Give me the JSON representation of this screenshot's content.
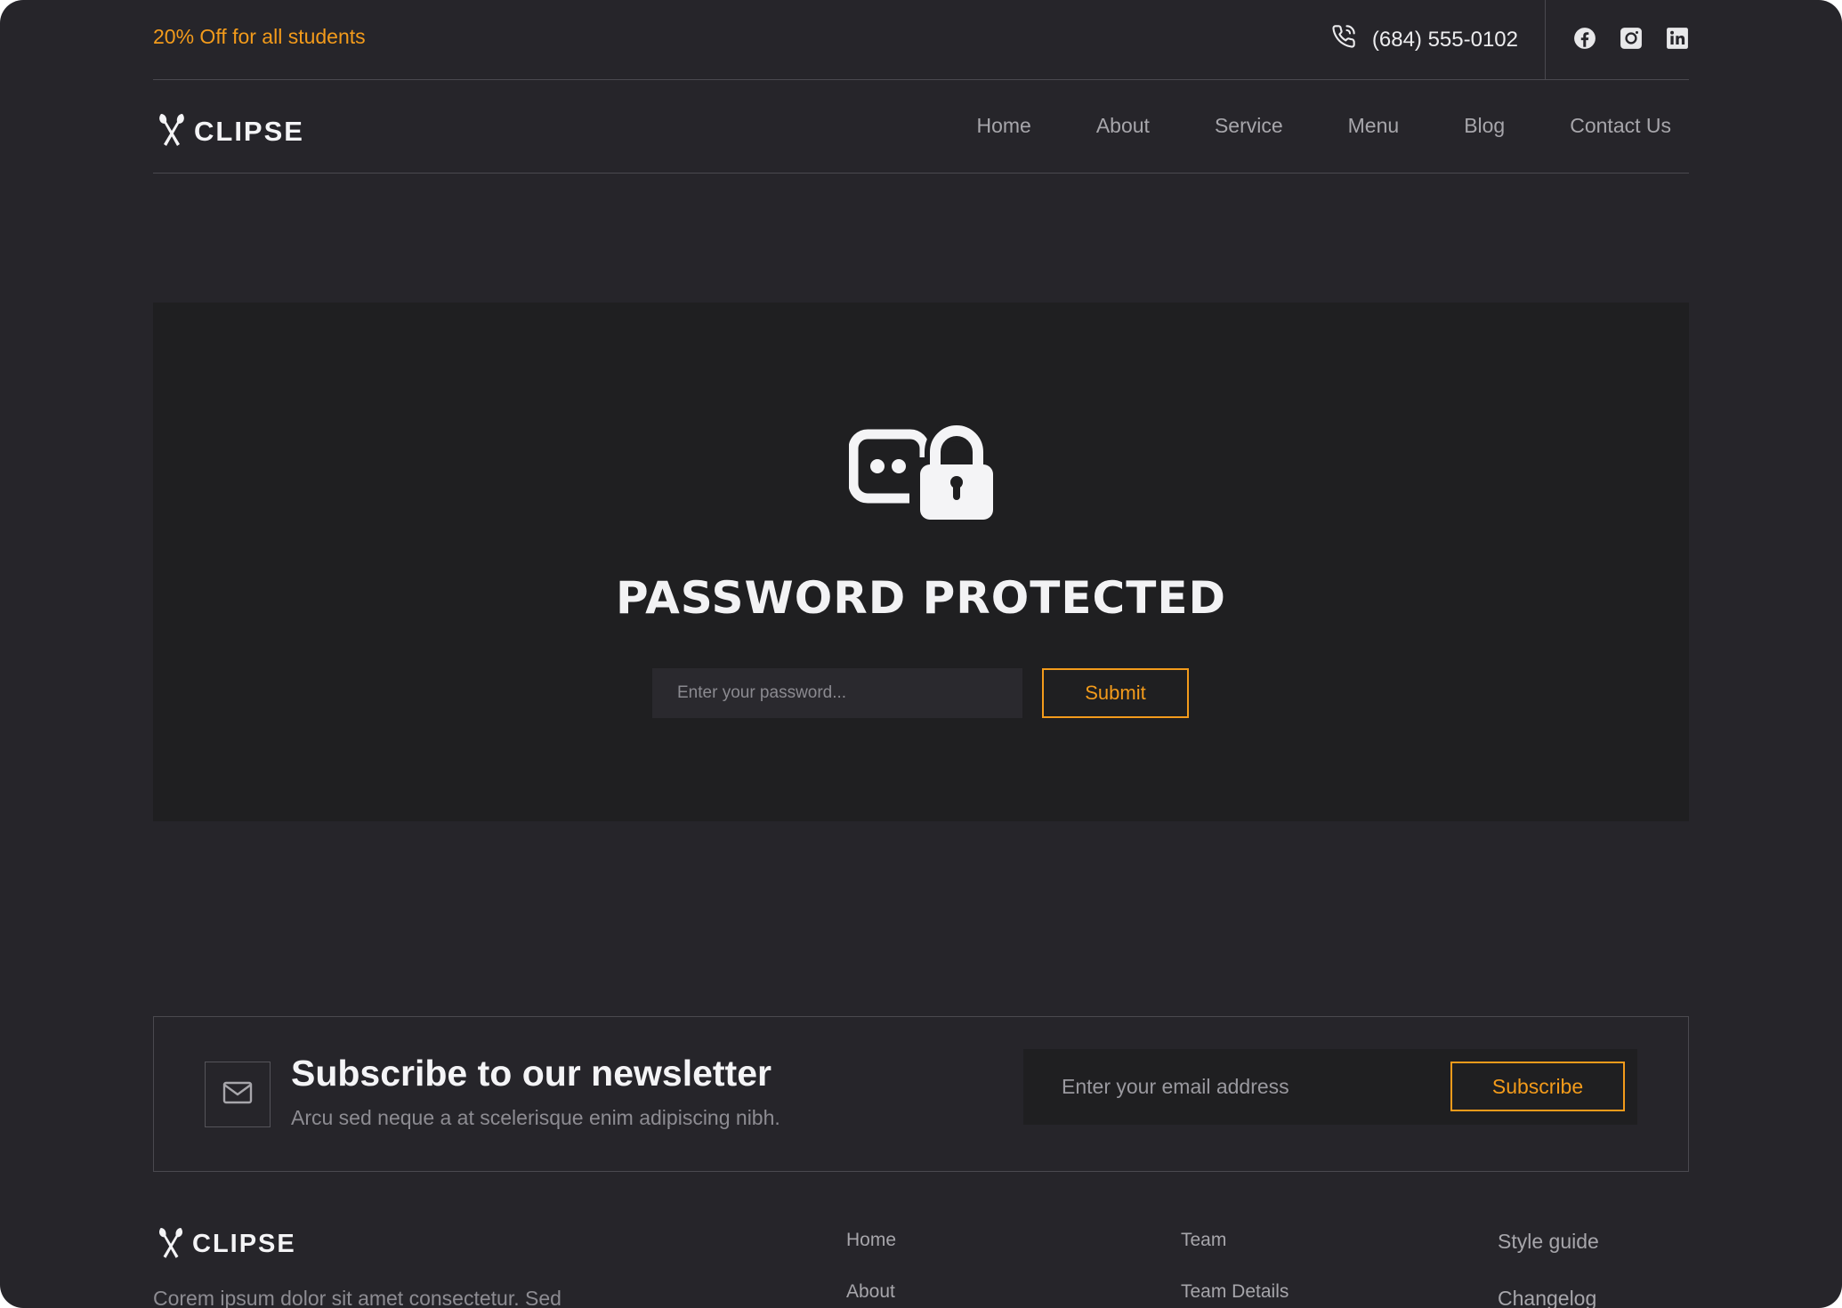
{
  "topbar": {
    "promo": "20% Off for all students",
    "phone": "(684) 555-0102",
    "socials": [
      "facebook-icon",
      "instagram-icon",
      "linkedin-icon"
    ]
  },
  "nav": {
    "brand": "CLIPSE",
    "items": [
      "Home",
      "About",
      "Service",
      "Menu",
      "Blog",
      "Contact Us"
    ]
  },
  "protected": {
    "title": "PASSWORD PROTECTED",
    "placeholder": "Enter your password...",
    "submit": "Submit"
  },
  "newsletter": {
    "title": "Subscribe to our newsletter",
    "subtitle": "Arcu sed neque a at scelerisque enim adipiscing nibh.",
    "placeholder": "Enter your email address",
    "button": "Subscribe"
  },
  "footer": {
    "brand": "CLIPSE",
    "description": "Corem ipsum dolor sit amet consectetur. Sed",
    "col1": [
      "Home",
      "About"
    ],
    "col2": [
      "Team",
      "Team Details"
    ],
    "col3": [
      "Style guide",
      "Changelog"
    ]
  },
  "colors": {
    "background": "#26252a",
    "card": "#1f1f21",
    "accent": "#f39b1b",
    "text": "#f4f4f6",
    "muted": "#a7a6ab"
  }
}
